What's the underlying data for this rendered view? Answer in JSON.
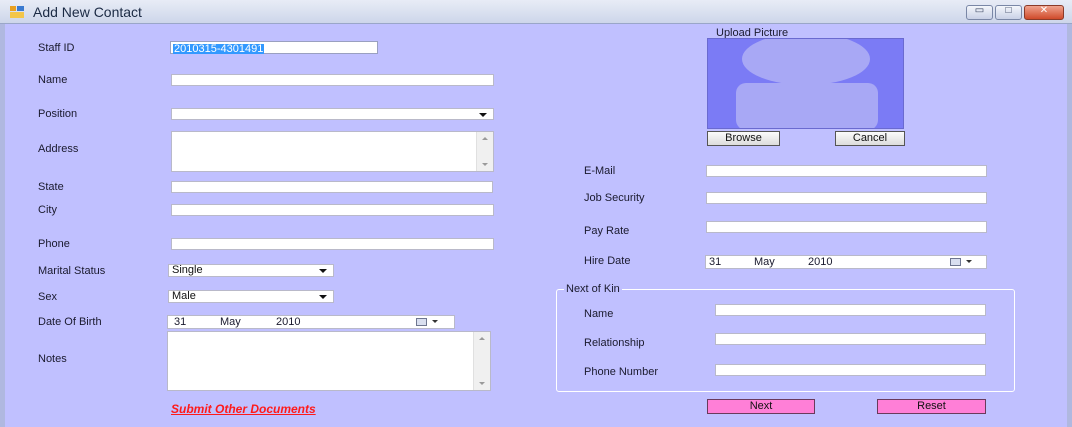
{
  "window": {
    "title": "Add New Contact",
    "minimize_glyph": "▭",
    "maximize_glyph": "□",
    "close_glyph": "✕"
  },
  "form": {
    "staff_id": {
      "label": "Staff ID",
      "value": "2010315-4301491"
    },
    "name": {
      "label": "Name",
      "value": ""
    },
    "position": {
      "label": "Position",
      "value": ""
    },
    "address": {
      "label": "Address",
      "value": ""
    },
    "state": {
      "label": "State",
      "value": ""
    },
    "city": {
      "label": "City",
      "value": ""
    },
    "phone": {
      "label": "Phone",
      "value": ""
    },
    "marital_status": {
      "label": "Marital Status",
      "value": "Single"
    },
    "sex": {
      "label": "Sex",
      "value": "Male"
    },
    "date_of_birth": {
      "label": "Date Of Birth",
      "day": "31",
      "month": "May",
      "year": "2010"
    },
    "notes": {
      "label": "Notes",
      "value": ""
    },
    "email": {
      "label": "E-Mail",
      "value": ""
    },
    "job_security": {
      "label": "Job Security",
      "value": ""
    },
    "pay_rate": {
      "label": "Pay Rate",
      "value": ""
    },
    "hire_date": {
      "label": "Hire Date",
      "day": "31",
      "month": "May",
      "year": "2010"
    }
  },
  "picture": {
    "label": "Upload Picture",
    "browse": "Browse",
    "cancel": "Cancel",
    "bg_color": "#7b7bf5",
    "silhouette_color": "#a8a8f5"
  },
  "next_of_kin": {
    "title": "Next of Kin",
    "name_label": "Name",
    "relationship_label": "Relationship",
    "phone_label": "Phone Number"
  },
  "actions": {
    "submit_docs": "Submit Other Documents",
    "next": "Next",
    "reset": "Reset"
  },
  "colors": {
    "form_bg": "#c0c0ff",
    "button_pink": "#ff7fd7",
    "link_red": "#ff1a1a",
    "selection_blue": "#3399ff"
  }
}
